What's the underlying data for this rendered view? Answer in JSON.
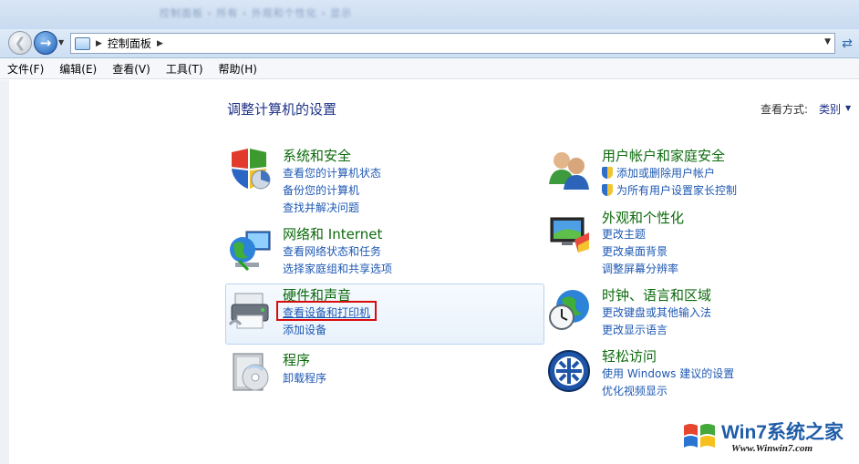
{
  "window": {
    "blurred_title": "控制面板 › 所有 › 外观和个性化 › 显示"
  },
  "nav": {
    "address_path": "控制面板"
  },
  "menu": [
    "文件(F)",
    "编辑(E)",
    "查看(V)",
    "工具(T)",
    "帮助(H)"
  ],
  "main": {
    "title": "调整计算机的设置",
    "view_by_label": "查看方式:",
    "view_by_value": "类别"
  },
  "categories": {
    "system": {
      "title": "系统和安全",
      "links": [
        "查看您的计算机状态",
        "备份您的计算机",
        "查找并解决问题"
      ]
    },
    "network": {
      "title": "网络和 Internet",
      "links": [
        "查看网络状态和任务",
        "选择家庭组和共享选项"
      ]
    },
    "hardware": {
      "title": "硬件和声音",
      "links": [
        "查看设备和打印机",
        "添加设备"
      ]
    },
    "programs": {
      "title": "程序",
      "links": [
        "卸载程序"
      ]
    },
    "users": {
      "title": "用户帐户和家庭安全",
      "links": [
        "添加或删除用户帐户",
        "为所有用户设置家长控制"
      ]
    },
    "appearance": {
      "title": "外观和个性化",
      "links": [
        "更改主题",
        "更改桌面背景",
        "调整屏幕分辨率"
      ]
    },
    "clock": {
      "title": "时钟、语言和区域",
      "links": [
        "更改键盘或其他输入法",
        "更改显示语言"
      ]
    },
    "ease": {
      "title": "轻松访问",
      "links": [
        "使用 Windows 建议的设置",
        "优化视频显示"
      ]
    }
  },
  "watermark": {
    "brand": "Win7系统之家",
    "url": "Www.Winwin7.com"
  },
  "colors": {
    "category_title": "#0b6a0b",
    "link": "#1e58b3",
    "highlight_border": "#d90c0c"
  }
}
